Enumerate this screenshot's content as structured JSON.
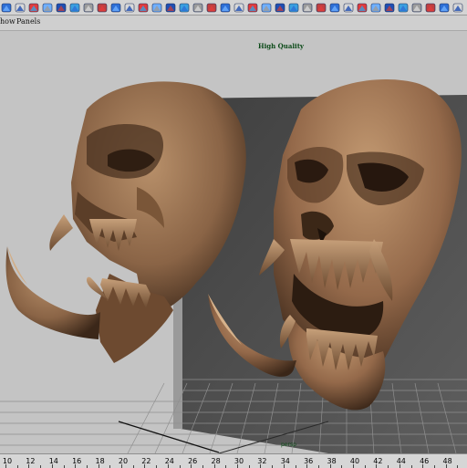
{
  "toolbar": {
    "icons": [
      "sphere-icon",
      "cube-icon",
      "cylinder-icon",
      "cone-icon",
      "plane-icon",
      "torus-icon",
      "curve-icon",
      "surface-icon",
      "polygon-icon",
      "subdiv-icon",
      "deformer-icon",
      "lattice-icon",
      "cluster-icon",
      "light-icon",
      "camera-icon",
      "material-icon",
      "texture-icon",
      "render-icon",
      "ipr-icon",
      "hypershade-icon",
      "paint-icon",
      "sculpt-icon",
      "joint-icon",
      "ik-icon",
      "skin-icon",
      "blendshape-icon",
      "wrap-icon",
      "cloth-icon",
      "hair-icon",
      "fluid-icon",
      "particle-icon",
      "field-icon",
      "checker-icon",
      "display-icon"
    ]
  },
  "panel_menu": {
    "items": [
      "how",
      "Panels"
    ]
  },
  "viewport": {
    "shading_label": "High Quality",
    "axis_label": "persp"
  },
  "timeline": {
    "ticks": [
      "10",
      "12",
      "14",
      "16",
      "18",
      "20",
      "22",
      "24",
      "26",
      "28",
      "30",
      "32",
      "34",
      "36",
      "38",
      "40",
      "42",
      "44",
      "46",
      "48"
    ]
  },
  "colors": {
    "bone_light": "#b48a64",
    "bone_dark": "#3a2618",
    "backdrop_dark": "#4c4c4c",
    "grid": "#8b8b8b"
  }
}
